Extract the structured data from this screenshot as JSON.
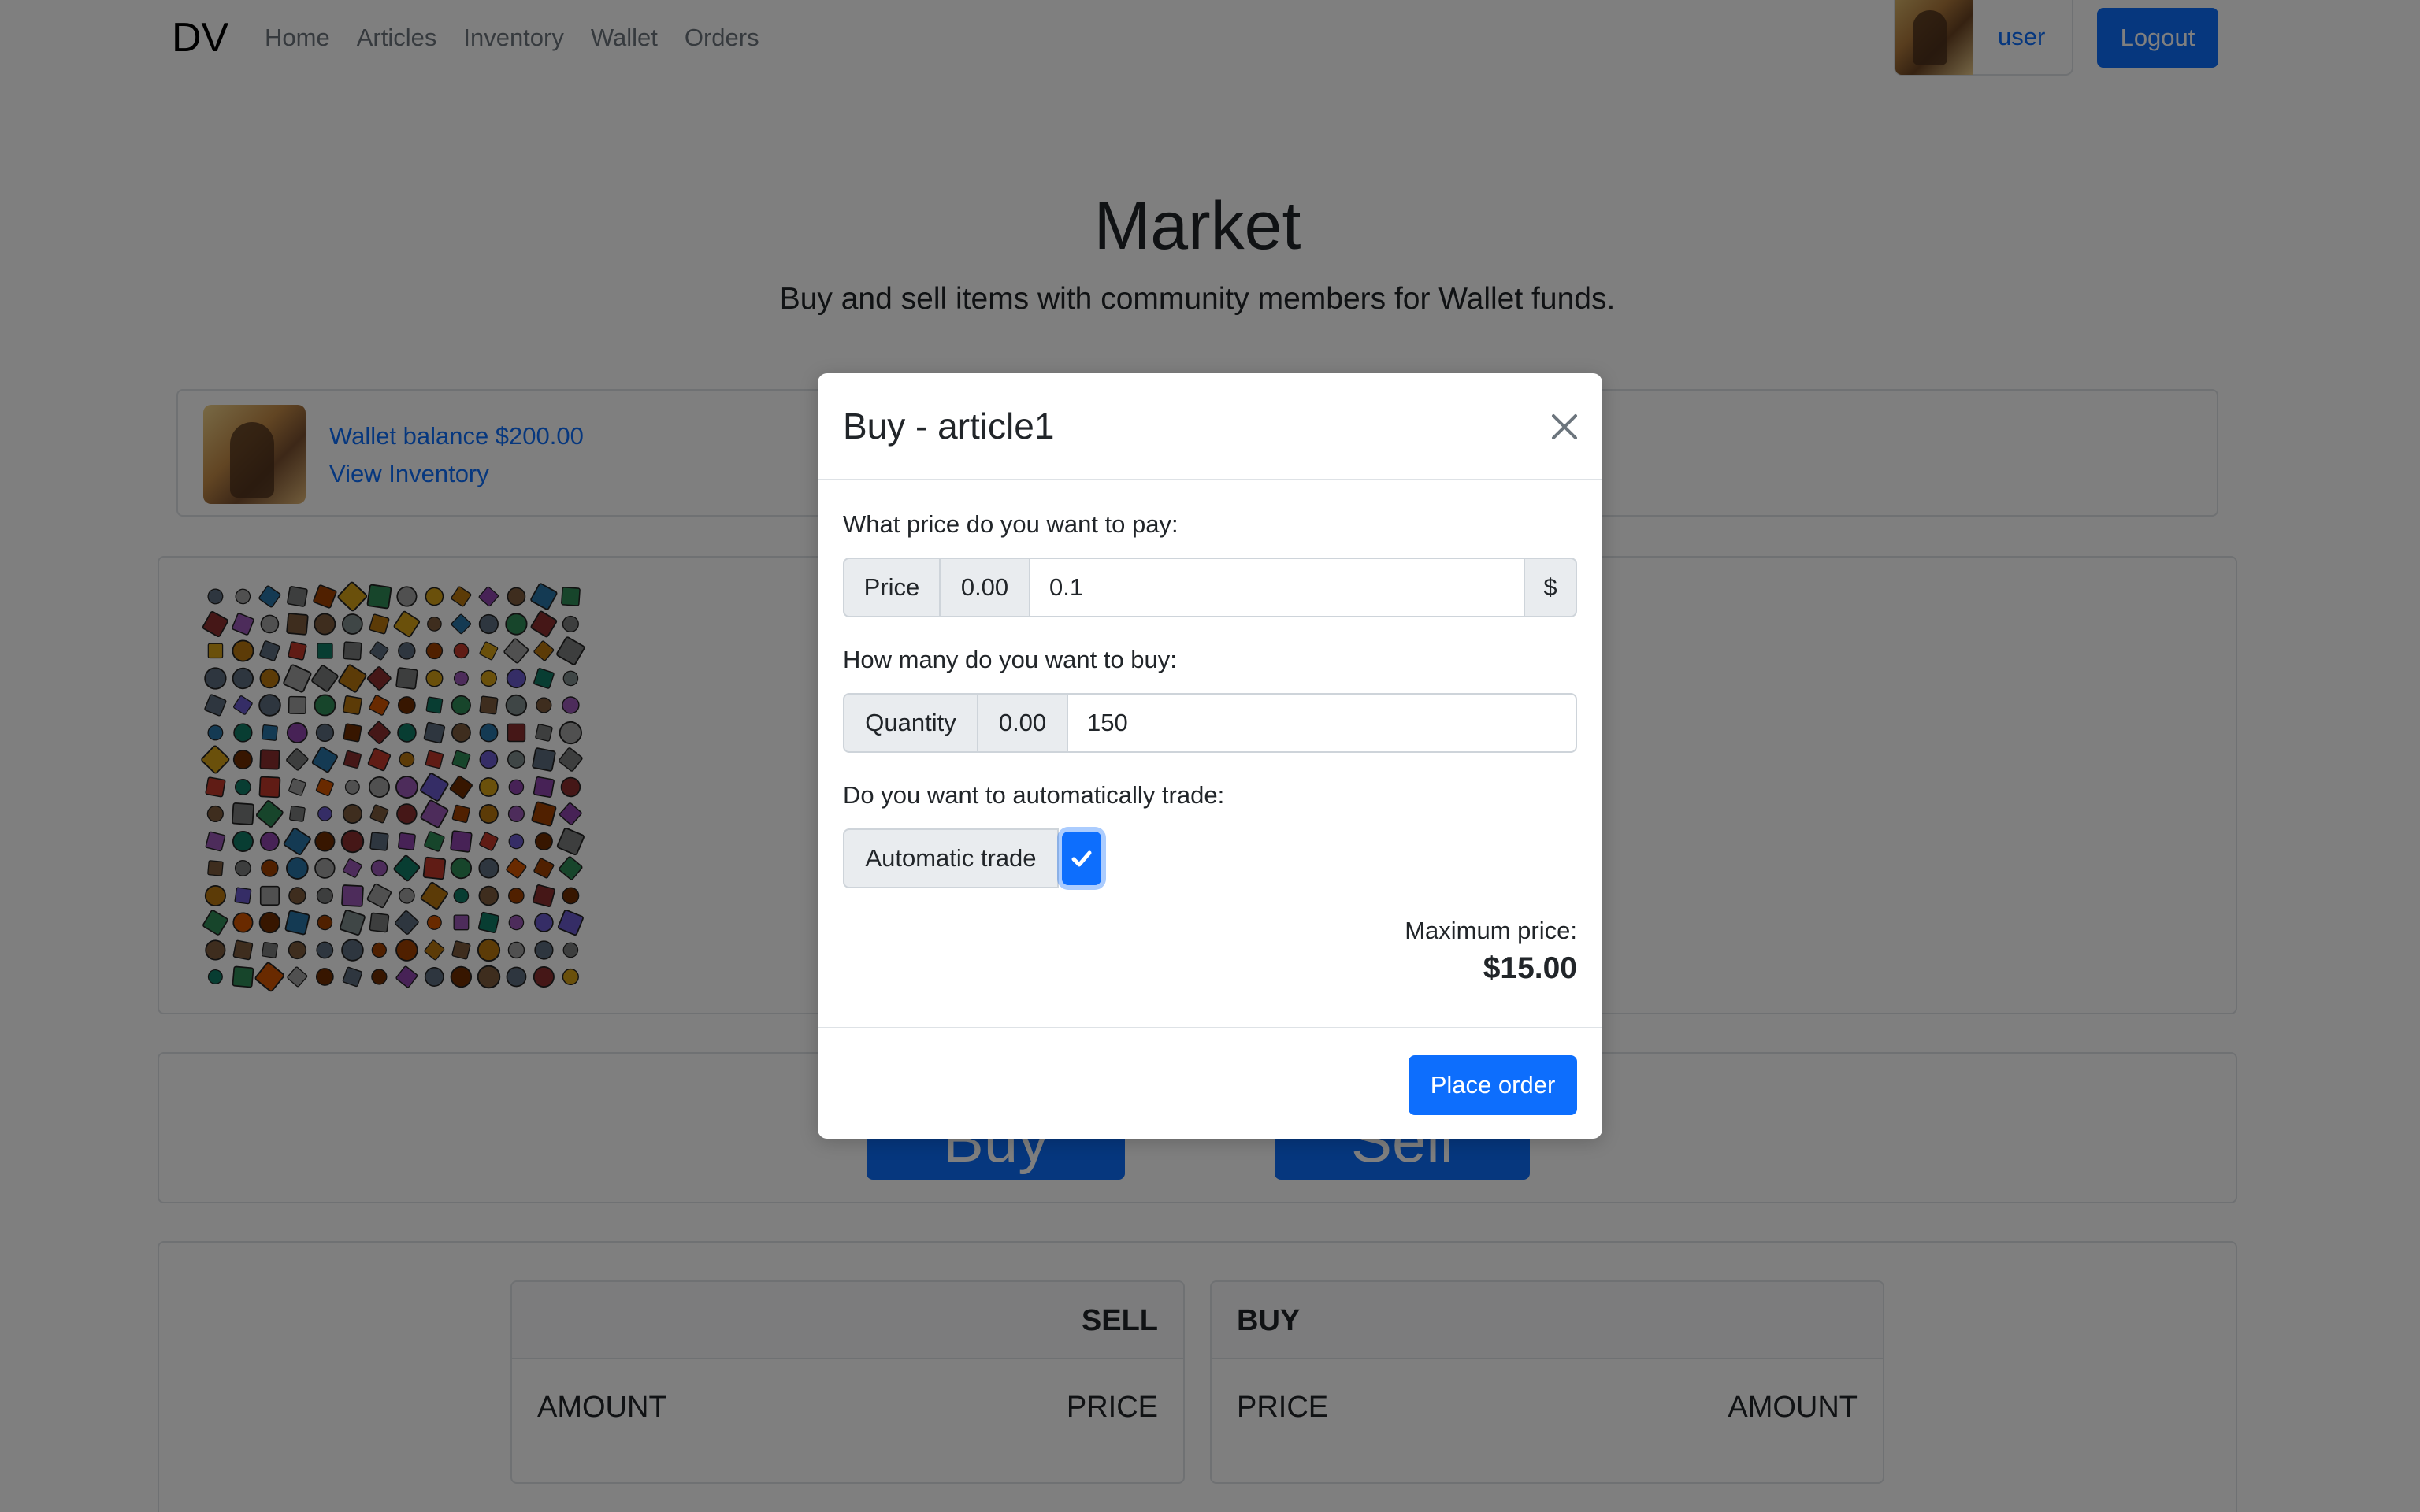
{
  "navbar": {
    "brand": "DV",
    "links": [
      "Home",
      "Articles",
      "Inventory",
      "Wallet",
      "Orders"
    ],
    "user_label": "user",
    "logout_label": "Logout"
  },
  "hero": {
    "title": "Market",
    "subtitle": "Buy and sell items with community members for Wallet funds."
  },
  "wallet": {
    "balance_text": "Wallet balance $200.00",
    "view_inventory": "View Inventory"
  },
  "actions": {
    "buy_label": "Buy",
    "sell_label": "Sell"
  },
  "orderbook": {
    "sell": {
      "title": "SELL",
      "col1": "AMOUNT",
      "col2": "PRICE"
    },
    "buy": {
      "title": "BUY",
      "col1": "PRICE",
      "col2": "AMOUNT"
    }
  },
  "modal": {
    "title": "Buy - article1",
    "price_question": "What price do you want to pay:",
    "price_label": "Price",
    "price_min": "0.00",
    "price_value": "0.1",
    "price_currency": "$",
    "quantity_question": "How many do you want to buy:",
    "quantity_label": "Quantity",
    "quantity_min": "0.00",
    "quantity_value": "150",
    "auto_question": "Do you want to automatically trade:",
    "auto_label": "Automatic trade",
    "auto_checked": true,
    "max_price_label": "Maximum price:",
    "max_price_value": "$15.00",
    "place_order_label": "Place order"
  },
  "colors": {
    "primary": "#0d6efd",
    "backdrop": "rgba(0,0,0,0.5)",
    "border": "#dee2e6",
    "input_group_bg": "#e9ecef"
  },
  "icons": {
    "close": "close-icon",
    "check": "check-icon"
  }
}
